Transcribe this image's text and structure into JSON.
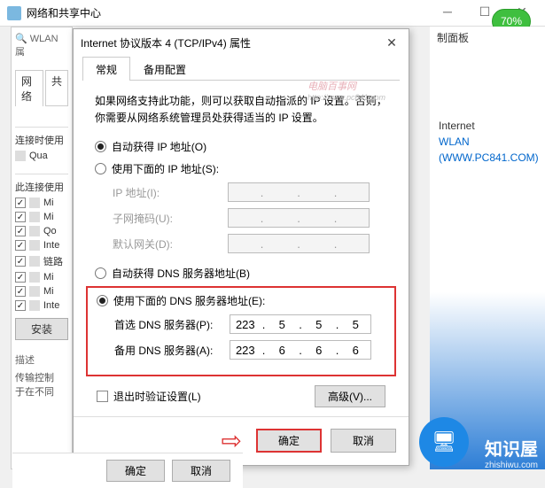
{
  "bg": {
    "title": "网络和共享中心",
    "wlan_label": "WLAN 属",
    "right_panel": "制面板",
    "percent": "70%",
    "brand": "知识屋",
    "brand_url": "zhishiwu.com"
  },
  "back_panel": {
    "tab_network": "网络",
    "tab_share": "共",
    "conn_label": "连接时使用",
    "adapter": "Qua",
    "list_label": "此连接使用",
    "items": [
      "Mi",
      "Mi",
      "Qo",
      "Inte",
      "链路",
      "Mi",
      "Mi",
      "Inte"
    ],
    "install": "安装",
    "desc_label": "描述",
    "desc_text1": "传输控制",
    "desc_text2": "于在不同"
  },
  "back_buttons": {
    "ok": "确定",
    "cancel": "取消"
  },
  "right_links": {
    "title": "Internet",
    "link1": "WLAN",
    "link2": "(WWW.PC841.COM)"
  },
  "dialog": {
    "title": "Internet 协议版本 4 (TCP/IPv4) 属性",
    "tab_general": "常规",
    "tab_alt": "备用配置",
    "intro": "如果网络支持此功能，则可以获取自动指派的 IP 设置。否则，你需要从网络系统管理员处获得适当的 IP 设置。",
    "ip": {
      "auto": "自动获得 IP 地址(O)",
      "manual": "使用下面的 IP 地址(S):",
      "addr_label": "IP 地址(I):",
      "mask_label": "子网掩码(U):",
      "gw_label": "默认网关(D):"
    },
    "dns": {
      "auto": "自动获得 DNS 服务器地址(B)",
      "manual": "使用下面的 DNS 服务器地址(E):",
      "pref_label": "首选 DNS 服务器(P):",
      "alt_label": "备用 DNS 服务器(A):",
      "pref_value": [
        "223",
        "5",
        "5",
        "5"
      ],
      "alt_value": [
        "223",
        "6",
        "6",
        "6"
      ]
    },
    "validate": "退出时验证设置(L)",
    "advanced": "高级(V)...",
    "ok": "确定",
    "cancel": "取消"
  },
  "watermark": {
    "line1": "电脑百事网",
    "line2": "http://www.pc841.com"
  }
}
